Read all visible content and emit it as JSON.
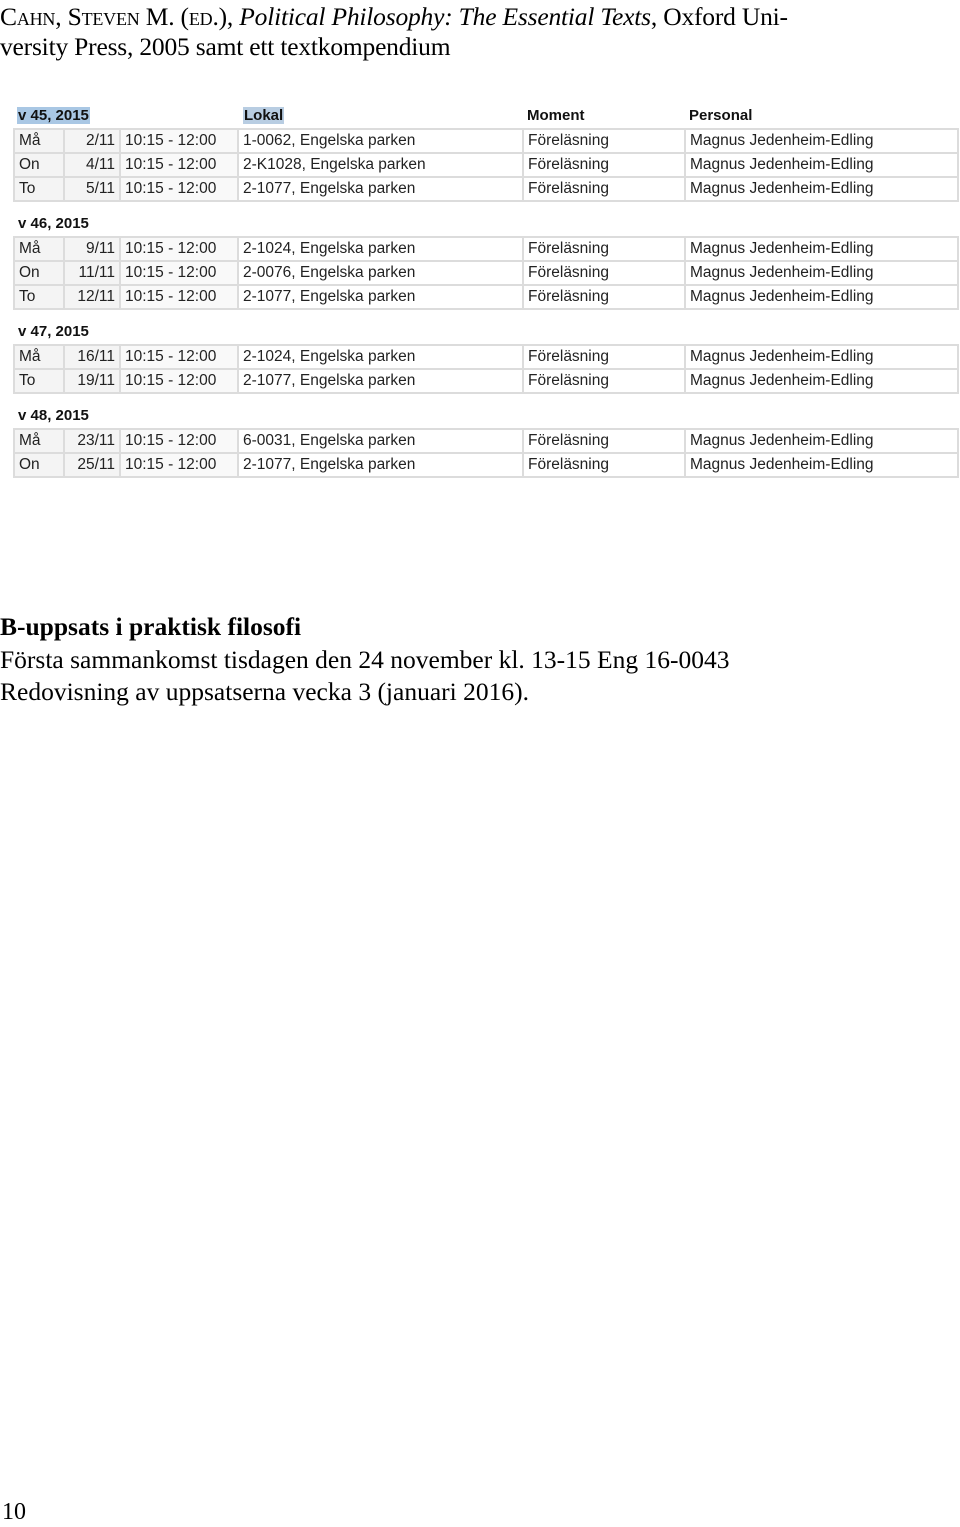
{
  "reference": {
    "author_first": "C",
    "author_first_sc": "ahn",
    "sep1": ", ",
    "author_second": "S",
    "author_second_sc": "teven",
    "initial": " M. (",
    "ed_sc": "ed",
    "after_ed": ".), ",
    "book_title": "Political Philosophy: The Essential Texts",
    "rest_line1": ", Oxford Uni-",
    "line2": "versity Press, 2005 samt ett textkompendium"
  },
  "schedule": {
    "columns": {
      "lokal": "Lokal",
      "moment": "Moment",
      "personal": "Personal"
    },
    "weeks": [
      {
        "label": "v 45, 2015",
        "rows": [
          {
            "day": "Må",
            "date": "2/11",
            "time": "10:15 - 12:00",
            "room": "1-0062, Engelska parken",
            "moment": "Föreläsning",
            "person": "Magnus Jedenheim-Edling"
          },
          {
            "day": "On",
            "date": "4/11",
            "time": "10:15 - 12:00",
            "room": "2-K1028, Engelska parken",
            "moment": "Föreläsning",
            "person": "Magnus Jedenheim-Edling"
          },
          {
            "day": "To",
            "date": "5/11",
            "time": "10:15 - 12:00",
            "room": "2-1077, Engelska parken",
            "moment": "Föreläsning",
            "person": "Magnus Jedenheim-Edling"
          }
        ]
      },
      {
        "label": "v 46, 2015",
        "rows": [
          {
            "day": "Må",
            "date": "9/11",
            "time": "10:15 - 12:00",
            "room": "2-1024, Engelska parken",
            "moment": "Föreläsning",
            "person": "Magnus Jedenheim-Edling"
          },
          {
            "day": "On",
            "date": "11/11",
            "time": "10:15 - 12:00",
            "room": "2-0076, Engelska parken",
            "moment": "Föreläsning",
            "person": "Magnus Jedenheim-Edling"
          },
          {
            "day": "To",
            "date": "12/11",
            "time": "10:15 - 12:00",
            "room": "2-1077, Engelska parken",
            "moment": "Föreläsning",
            "person": "Magnus Jedenheim-Edling"
          }
        ]
      },
      {
        "label": "v 47, 2015",
        "rows": [
          {
            "day": "Må",
            "date": "16/11",
            "time": "10:15 - 12:00",
            "room": "2-1024, Engelska parken",
            "moment": "Föreläsning",
            "person": "Magnus Jedenheim-Edling"
          },
          {
            "day": "To",
            "date": "19/11",
            "time": "10:15 - 12:00",
            "room": "2-1077, Engelska parken",
            "moment": "Föreläsning",
            "person": "Magnus Jedenheim-Edling"
          }
        ]
      },
      {
        "label": "v 48, 2015",
        "rows": [
          {
            "day": "Må",
            "date": "23/11",
            "time": "10:15 - 12:00",
            "room": "6-0031, Engelska parken",
            "moment": "Föreläsning",
            "person": "Magnus Jedenheim-Edling"
          },
          {
            "day": "On",
            "date": "25/11",
            "time": "10:15 - 12:00",
            "room": "2-1077, Engelska parken",
            "moment": "Föreläsning",
            "person": "Magnus Jedenheim-Edling"
          }
        ]
      }
    ],
    "highlight_color": "#a9c7e4",
    "border_color": "#dcdcdc"
  },
  "essay": {
    "title": "B-uppsats i praktisk filosofi",
    "line1": "Första sammankomst tisdagen den 24 november kl. 13-15 Eng 16-0043",
    "line2": "Redovisning av uppsatserna vecka 3 (januari 2016)."
  },
  "page_number": "10"
}
